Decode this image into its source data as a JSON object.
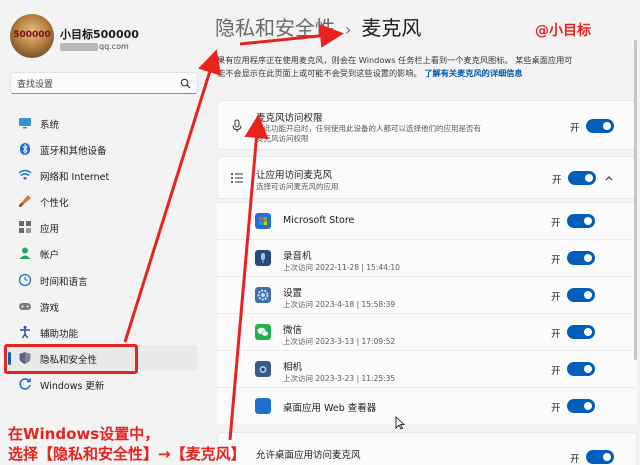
{
  "profile": {
    "avatar_text": "500000",
    "name": "小目标500000",
    "email_suffix": "qq.com"
  },
  "search": {
    "placeholder": "查找设置"
  },
  "sidebar": {
    "items": [
      {
        "label": "系统",
        "icon": "monitor-icon"
      },
      {
        "label": "蓝牙和其他设备",
        "icon": "bluetooth-icon"
      },
      {
        "label": "网络和 Internet",
        "icon": "wifi-icon"
      },
      {
        "label": "个性化",
        "icon": "brush-icon"
      },
      {
        "label": "应用",
        "icon": "apps-icon"
      },
      {
        "label": "帐户",
        "icon": "person-icon"
      },
      {
        "label": "时间和语言",
        "icon": "globe-clock-icon"
      },
      {
        "label": "游戏",
        "icon": "gamepad-icon"
      },
      {
        "label": "辅助功能",
        "icon": "accessibility-icon"
      },
      {
        "label": "隐私和安全性",
        "icon": "shield-icon",
        "active": true
      },
      {
        "label": "Windows 更新",
        "icon": "update-icon"
      }
    ]
  },
  "header": {
    "parent": "隐私和安全性",
    "separator": "›",
    "current": "麦克风",
    "watermark": "@小目标"
  },
  "description": {
    "line1": "果有应用程序正在使用麦克风，则会在 Windows 任务栏上看到一个麦克风图标。 某些桌面应用可",
    "line2_text": "能不会显示在此页面上或可能不会受到这些设置的影响。",
    "link": "了解有关麦克风的详细信息"
  },
  "mic_access": {
    "title": "麦克风访问权限",
    "subtitle_line1": "当此功能开启时，任何使用此设备的人都可以选择他们的应用是否有",
    "subtitle_line2": "麦克风访问权限",
    "toggle_label": "开",
    "on": true
  },
  "app_access": {
    "title": "让应用访问麦克风",
    "subtitle": "选择可访问麦克风的应用",
    "toggle_label": "开",
    "on": true,
    "expanded": true
  },
  "apps": [
    {
      "name": "Microsoft Store",
      "last_access": "",
      "toggle_label": "开",
      "on": true,
      "icon": "store-icon",
      "color": "#1f6fd0"
    },
    {
      "name": "录音机",
      "last_access": "上次访问 2022-11-28  |  15:44:10",
      "toggle_label": "开",
      "on": true,
      "icon": "recorder-icon",
      "color": "#2a4a7a"
    },
    {
      "name": "设置",
      "last_access": "上次访问 2023-4-18  |  15:58:39",
      "toggle_label": "开",
      "on": true,
      "icon": "settings-gear-icon",
      "color": "#3d6ea8"
    },
    {
      "name": "微信",
      "last_access": "上次访问 2023-3-13  |  17:09:52",
      "toggle_label": "开",
      "on": true,
      "icon": "wechat-icon",
      "color": "#22b14c"
    },
    {
      "name": "相机",
      "last_access": "上次访问 2023-3-23  |  11:25:35",
      "toggle_label": "开",
      "on": true,
      "icon": "camera-icon",
      "color": "#3b5b86"
    },
    {
      "name": "桌面应用 Web 查看器",
      "last_access": "",
      "toggle_label": "开",
      "on": true,
      "icon": "web-viewer-icon",
      "color": "#1f6fd0"
    }
  ],
  "desktop_apps": {
    "title": "允许桌面应用访问麦克风",
    "toggle_label": "开"
  },
  "annotation": {
    "caption_line1": "在Windows设置中，",
    "caption_line2": "选择【隐私和安全性】→【麦克风】"
  },
  "colors": {
    "accent": "#005fb8",
    "annotation_red": "#e8231f",
    "link": "#0055a8"
  }
}
